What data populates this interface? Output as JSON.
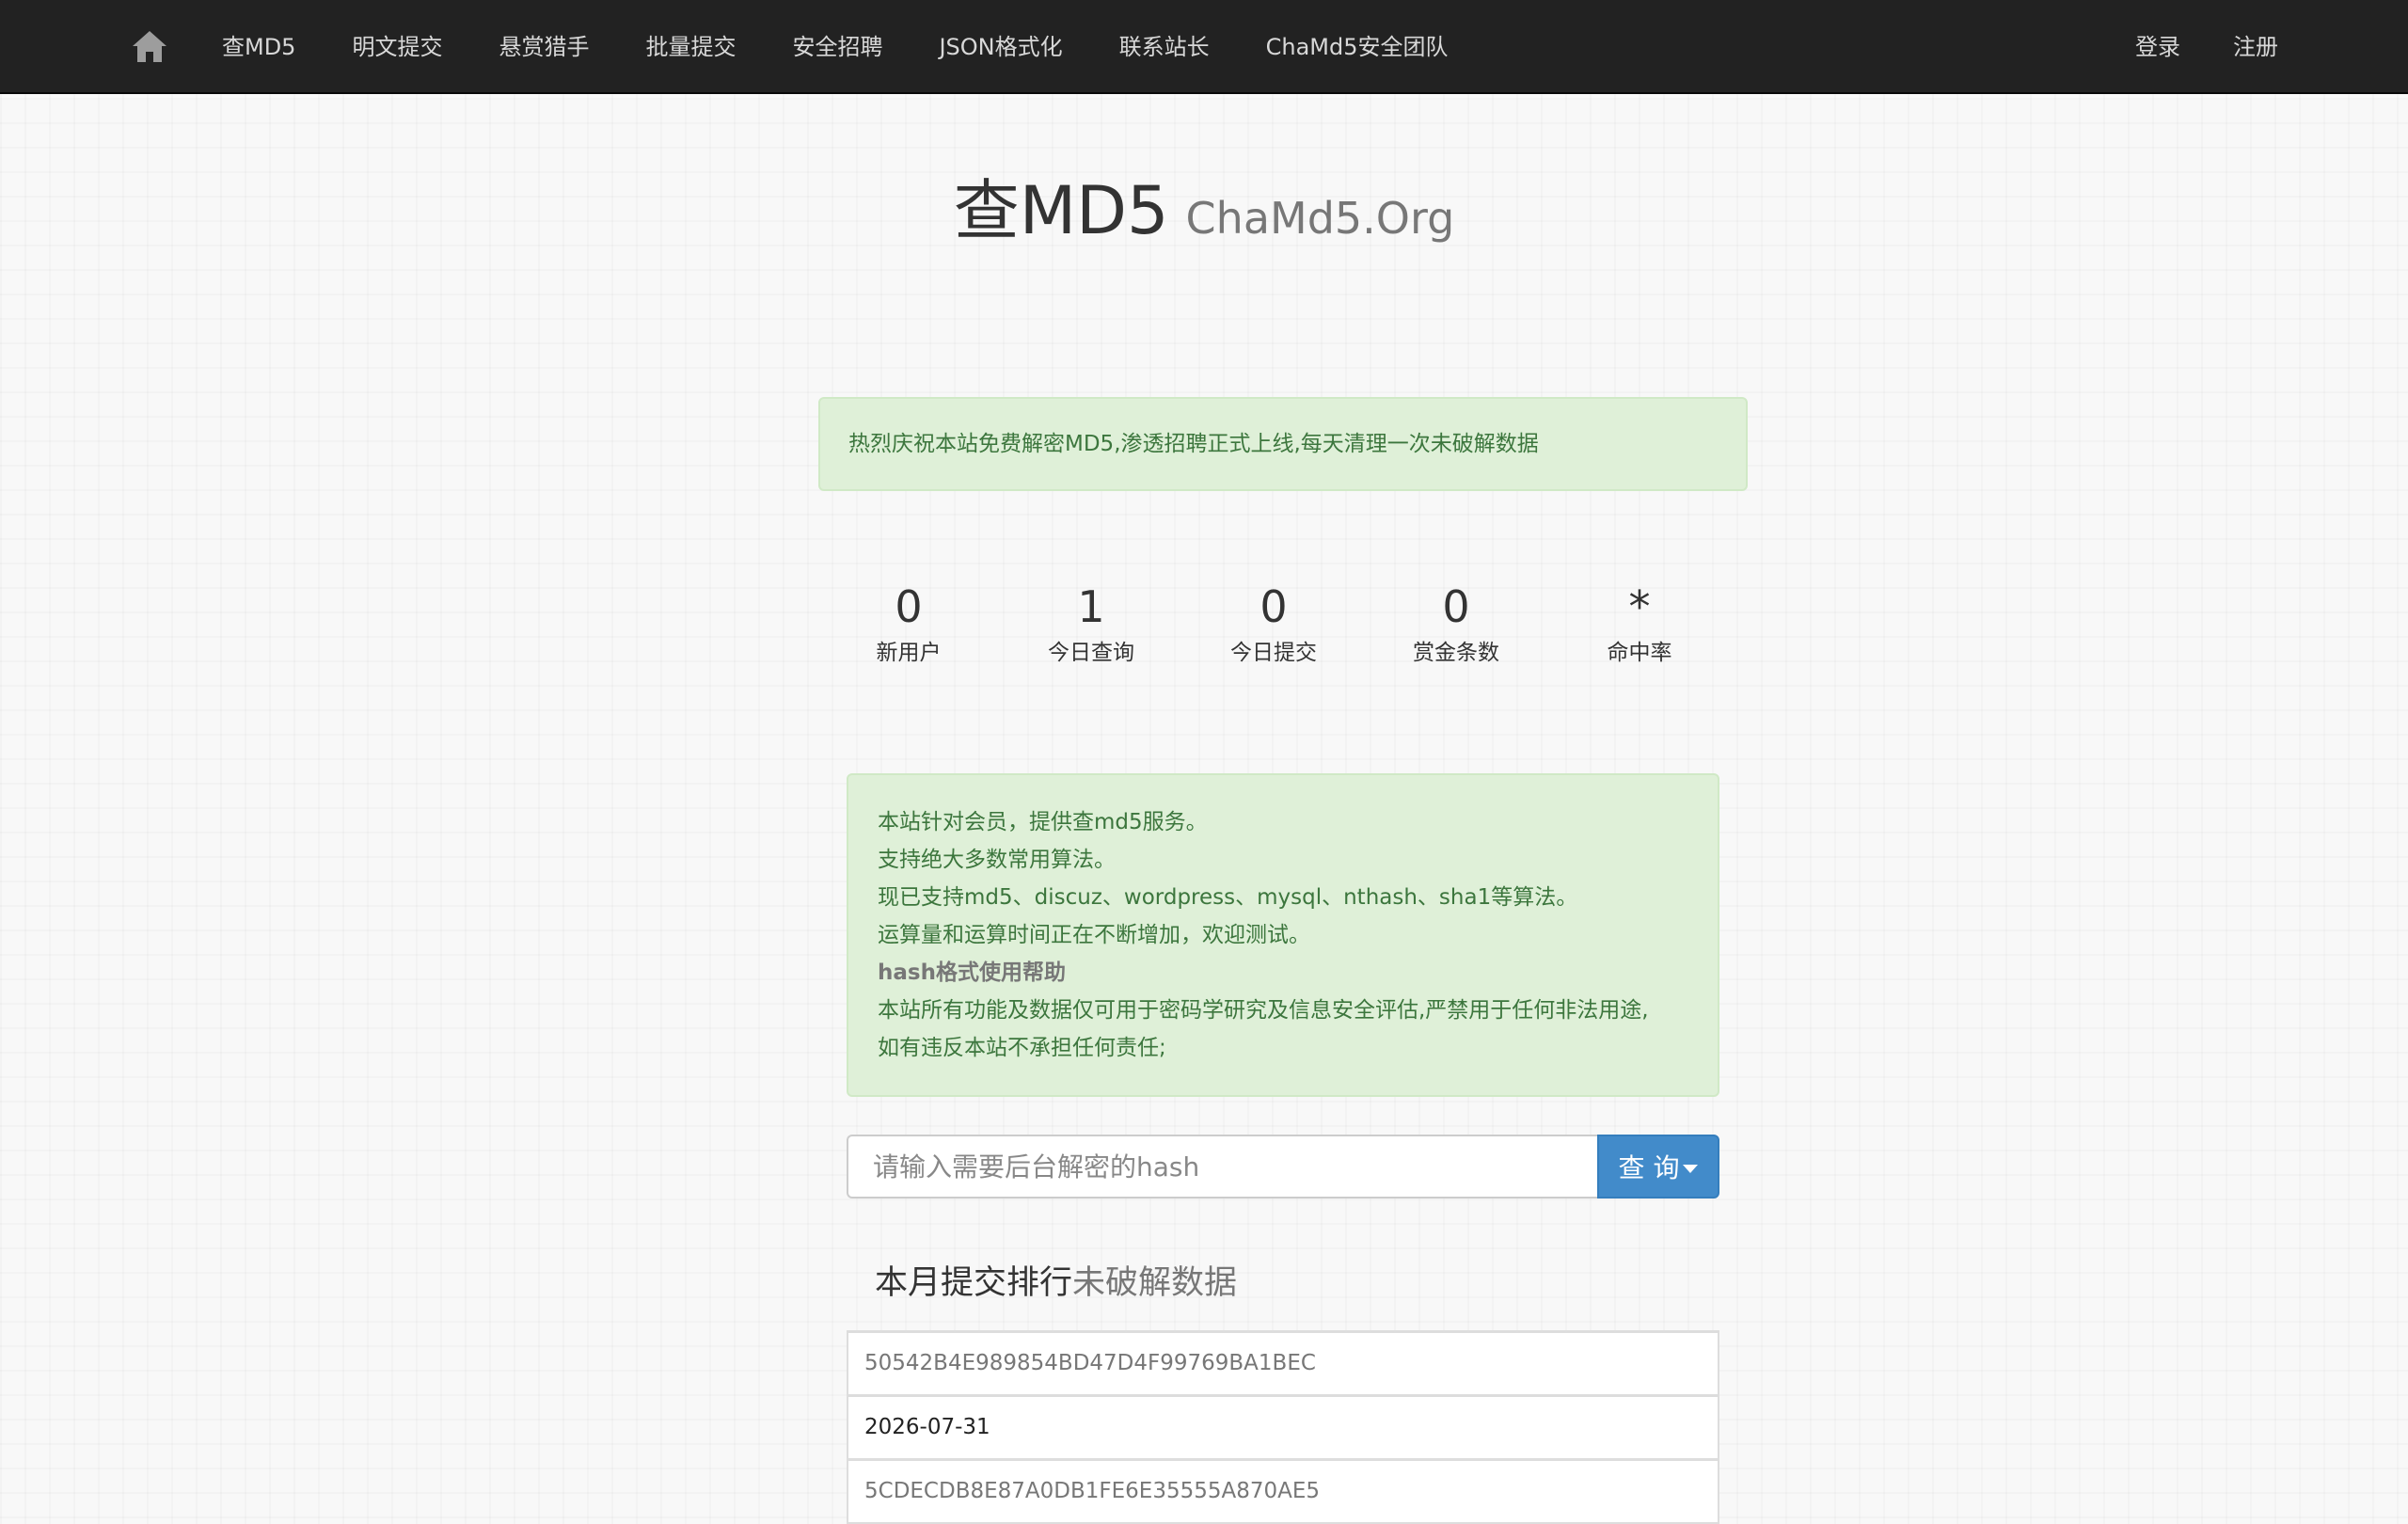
{
  "navbar": {
    "home_icon": "home-icon",
    "links": [
      {
        "label": "查MD5"
      },
      {
        "label": "明文提交"
      },
      {
        "label": "悬赏猎手"
      },
      {
        "label": "批量提交"
      },
      {
        "label": "安全招聘"
      },
      {
        "label": "JSON格式化"
      },
      {
        "label": "联系站长"
      },
      {
        "label": "ChaMd5安全团队"
      }
    ],
    "login": "登录",
    "register": "注册"
  },
  "title": {
    "main": "查MD5",
    "sub": "ChaMd5.Org"
  },
  "announcement": "热烈庆祝本站免费解密MD5,渗透招聘正式上线,每天清理一次未破解数据",
  "stats": [
    {
      "value": "0",
      "label": "新用户"
    },
    {
      "value": "1",
      "label": "今日查询"
    },
    {
      "value": "0",
      "label": "今日提交"
    },
    {
      "value": "0",
      "label": "赏金条数"
    },
    {
      "value": "*",
      "label": "命中率"
    }
  ],
  "info": {
    "lines": [
      "本站针对会员，提供查md5服务。",
      "支持绝大多数常用算法。",
      "现已支持md5、discuz、wordpress、mysql、nthash、sha1等算法。",
      "运算量和运算时间正在不断增加，欢迎测试。"
    ],
    "help_link": "hash格式使用帮助",
    "disclaimer_lines": [
      "本站所有功能及数据仅可用于密码学研究及信息安全评估,严禁用于任何非法用途,",
      "如有违反本站不承担任何责任;"
    ]
  },
  "search": {
    "placeholder": "请输入需要后台解密的hash",
    "value": "",
    "button_label": "查 询"
  },
  "ranking": {
    "title": "本月提交排行",
    "link": "未破解数据",
    "items": [
      {
        "text": "50542B4E989854BD47D4F99769BA1BEC",
        "kind": "hash"
      },
      {
        "text": "2026-07-31",
        "kind": "date"
      },
      {
        "text": "5CDECDB8E87A0DB1FE6E35555A870AE5",
        "kind": "hash"
      }
    ]
  },
  "colors": {
    "navbar_bg": "#222222",
    "alert_bg": "#dff0d8",
    "alert_text": "#3c763d",
    "primary_button": "#428bca"
  }
}
